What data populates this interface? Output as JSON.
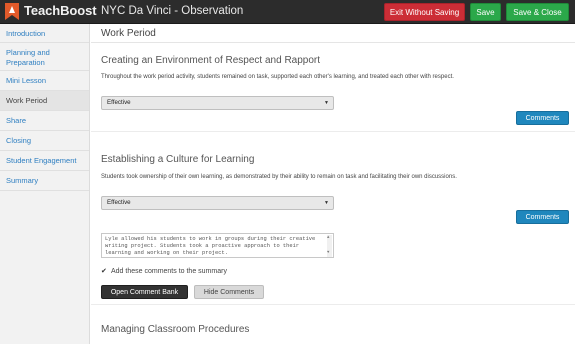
{
  "app": {
    "brand": "TeachBoost",
    "page_title": "NYC Da Vinci - Observation"
  },
  "toolbar": {
    "exit_label": "Exit Without Saving",
    "save_label": "Save",
    "save_close_label": "Save & Close"
  },
  "colors": {
    "topbar": "#2c2c2c",
    "danger": "#cc2d36",
    "success": "#2ba84a",
    "primary": "#1f87bd",
    "link": "#2f7fc1"
  },
  "sidebar": {
    "items": [
      {
        "label": "Introduction"
      },
      {
        "label_line1": "Planning and",
        "label_line2": "Preparation"
      },
      {
        "label": "Mini Lesson"
      },
      {
        "label": "Work Period"
      },
      {
        "label": "Share"
      },
      {
        "label": "Closing"
      },
      {
        "label": "Student Engagement"
      },
      {
        "label": "Summary"
      }
    ],
    "active": "Work Period"
  },
  "main": {
    "section_title": "Work Period",
    "criteria": [
      {
        "title": "Creating an Environment of Respect and Rapport",
        "description": "Throughout the work period activity, students remained on task, supported each other's learning, and treated each other with respect.",
        "rating": "Effective",
        "comments_button": "Comments"
      },
      {
        "title": "Establishing a Culture for Learning",
        "description": "Students took ownership of their own learning, as demonstrated by their ability to remain on task and facilitating their own discussions.",
        "rating": "Effective",
        "comments_button": "Comments",
        "comment_text": "Lyle allowed his students to work in groups during their creative writing project. Students took a proactive approach to their learning and working on their project.",
        "add_to_summary_label": "Add these comments to the summary",
        "add_to_summary_checked": true,
        "open_bank_label": "Open Comment Bank",
        "hide_comments_label": "Hide Comments"
      },
      {
        "title": "Managing Classroom Procedures"
      }
    ]
  },
  "icons": {
    "logo": "teachboost-logo",
    "select_arrow": "chevron-down-icon",
    "check": "check-icon"
  }
}
